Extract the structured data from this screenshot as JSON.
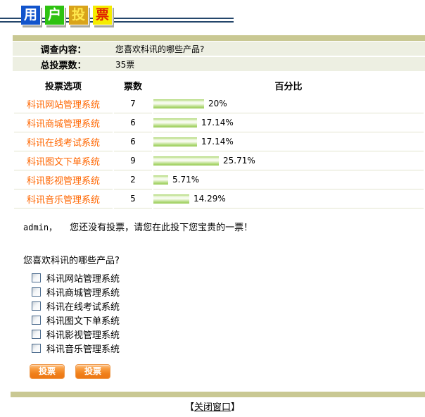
{
  "logo": {
    "blocks": [
      {
        "char": "用"
      },
      {
        "char": "户"
      },
      {
        "char": "投"
      },
      {
        "char": "票"
      }
    ]
  },
  "colors": {
    "accent_orange": "#FF6600",
    "olive_divider": "#C9C893",
    "info_row_bg": "#EDEFE2",
    "row_separator": "#E2E4CE",
    "bar_green": "#96CB52",
    "navy_line": "#24466B",
    "button_orange": "#F0801C",
    "logo_blue": "#1254CC",
    "logo_green": "#2EC211",
    "logo_gold": "#D9A41B",
    "logo_yellow": "#F5EC00",
    "logo_red_text": "#E02000"
  },
  "survey": {
    "content_label": "调查内容：",
    "content_value": "您喜欢科讯的哪些产品?",
    "total_label": "总投票数：",
    "total_value": "35票"
  },
  "results": {
    "headers": {
      "option": "投票选项",
      "votes": "票数",
      "percent": "百分比"
    },
    "rows": [
      {
        "option": "科讯网站管理系统",
        "votes": "7",
        "percent": 20,
        "percent_label": "20%"
      },
      {
        "option": "科讯商城管理系统",
        "votes": "6",
        "percent": 17.14,
        "percent_label": "17.14%"
      },
      {
        "option": "科讯在线考试系统",
        "votes": "6",
        "percent": 17.14,
        "percent_label": "17.14%"
      },
      {
        "option": "科讯图文下单系统",
        "votes": "9",
        "percent": 25.71,
        "percent_label": "25.71%"
      },
      {
        "option": "科讯影视管理系统",
        "votes": "2",
        "percent": 5.71,
        "percent_label": "5.71%"
      },
      {
        "option": "科讯音乐管理系统",
        "votes": "5",
        "percent": 14.29,
        "percent_label": "14.29%"
      }
    ]
  },
  "prompt": {
    "user": "admin，",
    "message": "您还没有投票，请您在此投下您宝贵的一票！",
    "question": "您喜欢科讯的哪些产品?"
  },
  "form": {
    "options": [
      "科讯网站管理系统",
      "科讯商城管理系统",
      "科讯在线考试系统",
      "科讯图文下单系统",
      "科讯影视管理系统",
      "科讯音乐管理系统"
    ],
    "submit_label": "投票",
    "submit2_label": "投票"
  },
  "footer": {
    "bracket_open": "【",
    "close_text": "关闭窗口",
    "bracket_close": "】"
  }
}
